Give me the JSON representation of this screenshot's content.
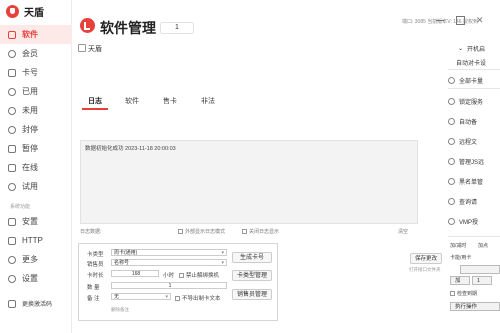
{
  "app": {
    "name": "天盾"
  },
  "sidebar": {
    "section_label": "系统功能",
    "items": [
      {
        "label": "软件",
        "icon": "software-icon"
      },
      {
        "label": "会员",
        "icon": "member-icon"
      },
      {
        "label": "卡号",
        "icon": "card-icon"
      },
      {
        "label": "已用",
        "icon": "used-icon"
      },
      {
        "label": "未用",
        "icon": "unused-icon"
      },
      {
        "label": "封停",
        "icon": "ban-icon"
      },
      {
        "label": "暂停",
        "icon": "pause-icon"
      },
      {
        "label": "在线",
        "icon": "online-icon"
      },
      {
        "label": "试用",
        "icon": "trial-icon"
      },
      {
        "label": "安置",
        "icon": "setup-icon"
      },
      {
        "label": "HTTP",
        "icon": "http-icon"
      },
      {
        "label": "更多",
        "icon": "more-icon"
      },
      {
        "label": "设置",
        "icon": "settings-icon"
      },
      {
        "label": "更换激活码",
        "icon": "swap-icon"
      }
    ]
  },
  "header": {
    "title": "软件管理",
    "count": "1",
    "info": "端口: 3085 当前版本V: 146 授权到"
  },
  "software": {
    "name": "天盾"
  },
  "tabs": [
    {
      "label": "日志"
    },
    {
      "label": "软件"
    },
    {
      "label": "售卡"
    },
    {
      "label": "非法"
    }
  ],
  "log": {
    "entry": "数据初始化成功 2023-11-18 20:00:03",
    "footer_left": "日志数据:",
    "opt_outside": "外部显示日志模式",
    "opt_close": "关闭日志显示",
    "clear": "清空"
  },
  "form": {
    "card_type_label": "卡类型",
    "card_type_value": "周卡(通用)",
    "seller_label": "销售员",
    "seller_value": "名称号",
    "duration_label": "卡时长",
    "duration_value": "168",
    "duration_unit": "小时",
    "unbind_label": "禁止解绑换机",
    "quantity_label": "数 量",
    "quantity_value": "1",
    "note_label": "备 注",
    "note_value": "无",
    "no_export_label": "不导出制卡文本",
    "help_link": "删除备注",
    "btn_generate": "生成卡号",
    "btn_card_type": "卡类型管理",
    "btn_seller": "销售员管理"
  },
  "save": {
    "button": "保存更改",
    "link": "打开接口文件夹"
  },
  "right_panel": {
    "items": [
      "开机启",
      "自动对卡设",
      "全部卡量",
      "锁定服务",
      "自动备",
      "远程文",
      "管理JS远",
      "黑名单管",
      "查询请",
      "VMP授"
    ],
    "add_time_label": "加/减时",
    "add_point_label": "加点",
    "card_no_label": "卡能/用卡",
    "op_select": "加",
    "op_value": "1",
    "check_label": "检查到期",
    "exec_button": "执行操作"
  }
}
